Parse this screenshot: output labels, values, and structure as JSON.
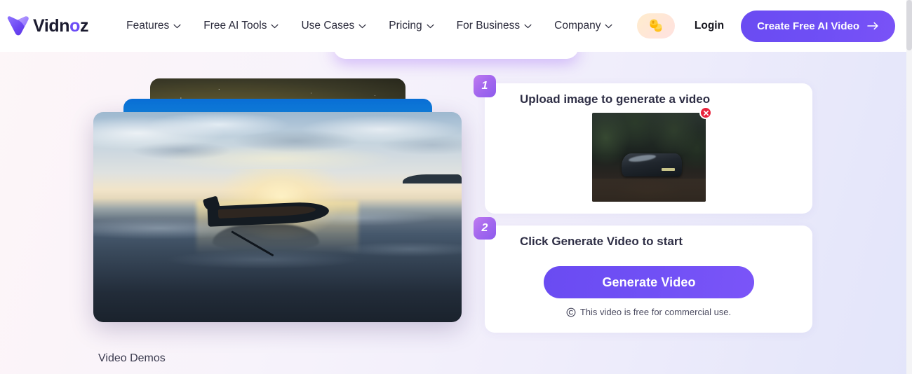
{
  "brand": {
    "name": "Vidnoz",
    "logo_icon": "vidnoz-v-swoosh-icon",
    "accent": "#6c4df6"
  },
  "header": {
    "nav": [
      {
        "label": "Features",
        "icon": "chevron-down-icon"
      },
      {
        "label": "Free AI Tools",
        "icon": "chevron-down-icon"
      },
      {
        "label": "Use Cases",
        "icon": "chevron-down-icon"
      },
      {
        "label": "Pricing",
        "icon": "chevron-down-icon"
      },
      {
        "label": "For Business",
        "icon": "chevron-down-icon"
      },
      {
        "label": "Company",
        "icon": "chevron-down-icon"
      }
    ],
    "credits_icon": "coins-icon",
    "login_label": "Login",
    "cta_label": "Create Free AI Video",
    "cta_icon": "arrow-right-icon",
    "cta_color": "#6f4ff5"
  },
  "preview": {
    "front_image_alt": "boat-on-calm-water-at-sunset",
    "mid_layer_alt": "blue-sky-video-card",
    "back_layer_alt": "night-starfield-video-card",
    "section_label": "Video Demos"
  },
  "steps": [
    {
      "number": "1",
      "title": "Upload image to generate a video",
      "thumbnail_alt": "uploaded-car-in-forest-driveway",
      "remove_icon": "close-x-icon",
      "remove_color": "#e8233c"
    },
    {
      "number": "2",
      "title": "Click Generate Video to start",
      "button_label": "Generate Video",
      "button_color": "#6f4ff5",
      "note_icon": "copyright-icon",
      "note": "This video is free for commercial use."
    }
  ],
  "scrollbar": {
    "orientation": "vertical",
    "thumb_position_percent": 0
  }
}
